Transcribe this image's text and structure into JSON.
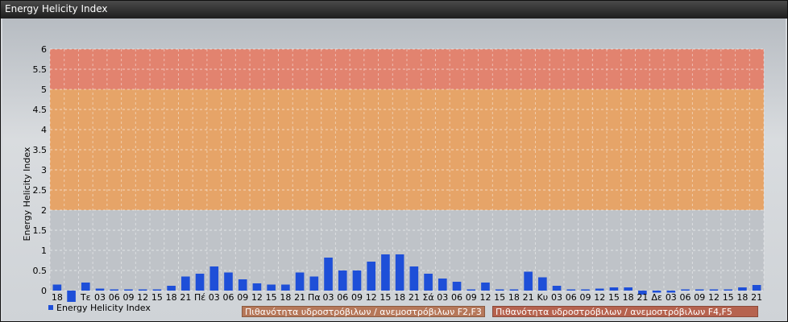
{
  "window": {
    "title": "Energy Helicity Index"
  },
  "colors": {
    "bar": "#1e4fd8",
    "band_low": "#bfc3c8",
    "band_mid": "#e6a468",
    "band_high": "#e2836f",
    "box_f2f3": "#b6785a",
    "box_f4f5": "#b6634f"
  },
  "chart_data": {
    "type": "bar",
    "title": "",
    "xlabel": "",
    "ylabel": "Energy Helicity Index",
    "ylim": [
      -0.25,
      6
    ],
    "yticks": [
      "0",
      "0.5",
      "1",
      "1.5",
      "2",
      "2.5",
      "3",
      "3.5",
      "4",
      "4.5",
      "5",
      "5.5",
      "6"
    ],
    "grid": true,
    "legend_placement": "bottom-left",
    "bands": [
      {
        "from": 0,
        "to": 2,
        "color": "band_low"
      },
      {
        "from": 2,
        "to": 5,
        "color": "band_mid"
      },
      {
        "from": 5,
        "to": 6,
        "color": "band_high"
      }
    ],
    "categories": [
      "18",
      "21",
      "Τε",
      "03",
      "06",
      "09",
      "12",
      "15",
      "18",
      "21",
      "Πέ",
      "03",
      "06",
      "09",
      "12",
      "15",
      "18",
      "21",
      "Πα",
      "03",
      "06",
      "09",
      "12",
      "15",
      "18",
      "21",
      "Σά",
      "03",
      "06",
      "09",
      "12",
      "15",
      "18",
      "21",
      "Κυ",
      "03",
      "06",
      "09",
      "12",
      "15",
      "18",
      "21",
      "Δε",
      "03",
      "06",
      "09",
      "12",
      "15",
      "18",
      "21"
    ],
    "xtick_labels": [
      "18",
      "",
      "Τε",
      "03",
      "06",
      "09",
      "12",
      "15",
      "18",
      "21",
      "Πέ",
      "03",
      "06",
      "09",
      "12",
      "15",
      "18",
      "21",
      "Πα",
      "03",
      "06",
      "09",
      "12",
      "15",
      "18",
      "21",
      "Σά",
      "03",
      "06",
      "09",
      "12",
      "15",
      "18",
      "21",
      "Κυ",
      "03",
      "06",
      "09",
      "12",
      "15",
      "18",
      "21",
      "Δε",
      "03",
      "06",
      "09",
      "12",
      "15",
      "18",
      "21"
    ],
    "series": [
      {
        "name": "Energy Helicity Index",
        "values": [
          0.15,
          -0.28,
          0.2,
          0.05,
          0.03,
          0.03,
          0.03,
          0.03,
          0.12,
          0.35,
          0.42,
          0.6,
          0.45,
          0.28,
          0.18,
          0.15,
          0.15,
          0.45,
          0.35,
          0.82,
          0.5,
          0.5,
          0.72,
          0.9,
          0.9,
          0.6,
          0.42,
          0.3,
          0.22,
          0.03,
          0.2,
          0.03,
          0.03,
          0.47,
          0.33,
          0.12,
          0.03,
          0.03,
          0.05,
          0.08,
          0.08,
          -0.1,
          -0.05,
          -0.05,
          0.03,
          0.03,
          0.03,
          0.03,
          0.08,
          0.14
        ]
      }
    ],
    "legend": "Energy Helicity Index",
    "annotations": [
      {
        "label": "Πιθανότητα υδροστρόβιλων / ανεμοστρόβιλων F2,F3",
        "color": "box_f2f3"
      },
      {
        "label": "Πιθανότητα υδροστρόβιλων / ανεμοστρόβιλων F4,F5",
        "color": "box_f4f5"
      }
    ]
  }
}
